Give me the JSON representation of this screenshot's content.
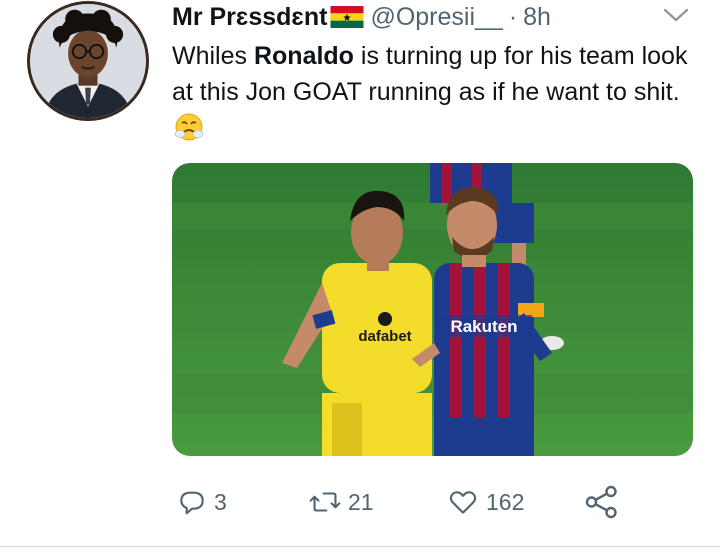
{
  "tweet": {
    "author_name": "Mr Prɛssdɛnt",
    "handle": "@Opresii__",
    "separator": "·",
    "time": "8h",
    "text_before": "Whiles ",
    "text_bold": "Ronaldo",
    "text_after": " is turning up for his team look at this Jon GOAT running as if he want to shit.",
    "flag_icon": "ghana-flag-icon",
    "emoji_icon": "face-with-steam-from-nose-icon"
  },
  "media": {
    "jersey_sponsor_left": "dafabet",
    "jersey_sponsor_right": "Rakuten"
  },
  "actions": {
    "reply_count": "3",
    "retweet_count": "21",
    "like_count": "162"
  },
  "colors": {
    "text": "#0f1419",
    "secondary": "#536471",
    "pitch": "#3f8f3a",
    "yellow_kit": "#f3dc2a",
    "barca_blue": "#1d3b8f",
    "barca_red": "#a3133c"
  }
}
